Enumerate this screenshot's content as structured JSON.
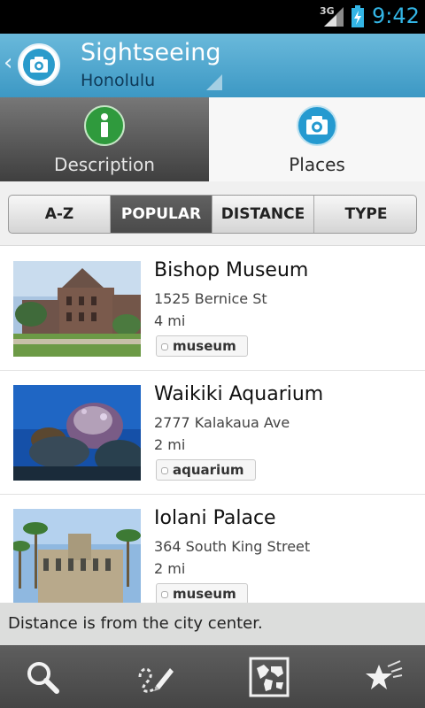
{
  "status_bar": {
    "network": "3G",
    "time": "9:42"
  },
  "action_bar": {
    "title": "Sightseeing",
    "subtitle": "Honolulu"
  },
  "tabs": [
    {
      "label": "Description",
      "icon": "info-icon",
      "active": false
    },
    {
      "label": "Places",
      "icon": "camera-icon",
      "active": true
    }
  ],
  "sort": {
    "options": [
      "A-Z",
      "POPULAR",
      "DISTANCE",
      "TYPE"
    ],
    "selected": "POPULAR"
  },
  "places": [
    {
      "name": "Bishop Museum",
      "address": "1525 Bernice St",
      "distance": "4 mi",
      "tag": "museum"
    },
    {
      "name": "Waikiki Aquarium",
      "address": "2777 Kalakaua Ave",
      "distance": "2 mi",
      "tag": "aquarium"
    },
    {
      "name": "Iolani Palace",
      "address": "364 South King Street",
      "distance": "2 mi",
      "tag": "museum"
    }
  ],
  "footer_note": "Distance is from the city center.",
  "bottom_bar": {
    "icons": [
      "search-icon",
      "draw-route-icon",
      "map-icon",
      "favorites-icon"
    ]
  },
  "colors": {
    "accent": "#33b5e5",
    "action_bar": "#4fa8d0",
    "info_green": "#2f9a3d",
    "camera_blue": "#259ad0"
  }
}
